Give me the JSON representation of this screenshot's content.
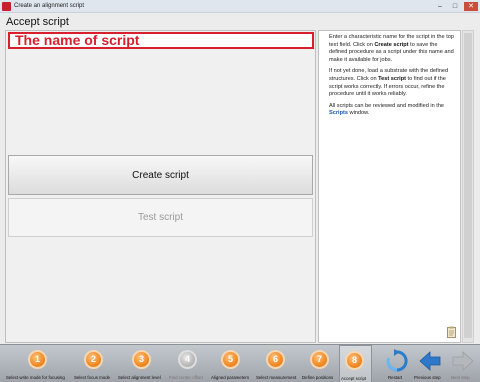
{
  "window": {
    "title": "Create an alignment script",
    "min": "–",
    "max": "□",
    "close": "✕"
  },
  "panel": {
    "title": "Accept script",
    "script_name_value": "The name of script",
    "create_button": "Create script",
    "test_button": "Test script"
  },
  "help": {
    "p1_a": "Enter a characteristic name for the script in the top text field. Click on ",
    "p1_b": "Create script",
    "p1_c": " to save the defined procedure as a script under this name and make it available for jobs.",
    "p2_a": "If not yet done, load a substrate with the defined structures. Click on ",
    "p2_b": "Test script",
    "p2_c": " to find out if the script works correctly. If errors occur, refine the procedure until it works reliably.",
    "p3_a": "All scripts can be reviewed and modified in the ",
    "p3_b": "Scripts",
    "p3_c": " window."
  },
  "steps": [
    {
      "num": "1",
      "label": "Select write mode for focusing",
      "enabled": true,
      "active": false
    },
    {
      "num": "2",
      "label": "Select focus mode",
      "enabled": true,
      "active": false
    },
    {
      "num": "3",
      "label": "Select alignment level",
      "enabled": true,
      "active": false
    },
    {
      "num": "4",
      "label": "Find center offset",
      "enabled": false,
      "active": false
    },
    {
      "num": "5",
      "label": "Aligned parameters",
      "enabled": true,
      "active": false
    },
    {
      "num": "6",
      "label": "Select measurement",
      "enabled": true,
      "active": false
    },
    {
      "num": "7",
      "label": "Define positions",
      "enabled": true,
      "active": false
    },
    {
      "num": "8",
      "label": "Accept script",
      "enabled": true,
      "active": true
    }
  ],
  "nav": {
    "restart": "Restart",
    "previous": "Previous step",
    "next": "Next step"
  },
  "colors": {
    "accent_red": "#d81f2e",
    "step_orange": "#f08a25",
    "link_blue": "#1d56b8"
  }
}
